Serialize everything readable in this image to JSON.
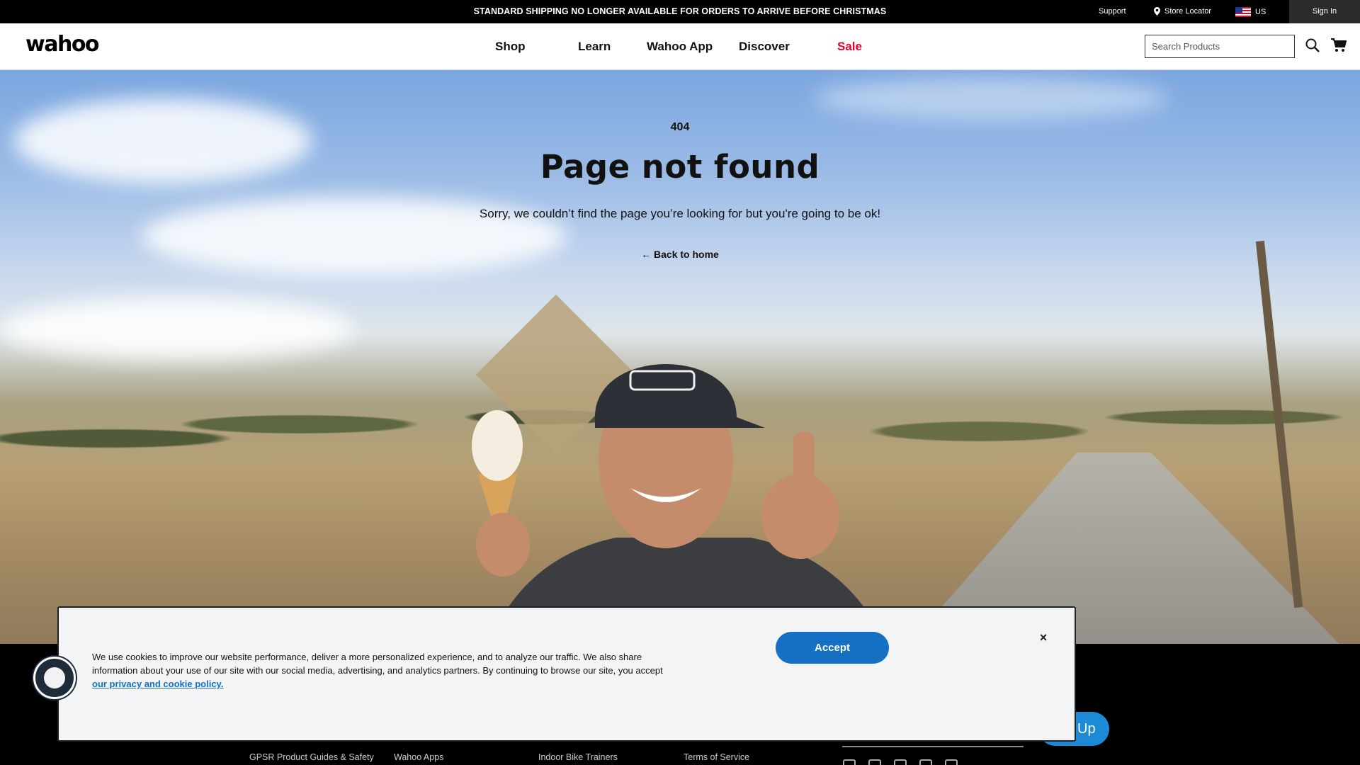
{
  "topbar": {
    "announcement": "STANDARD SHIPPING NO LONGER AVAILABLE FOR ORDERS TO ARRIVE BEFORE CHRISTMAS",
    "support": "Support",
    "store_locator": "Store Locator",
    "locale": "US",
    "sign_in": "Sign In"
  },
  "nav": {
    "logo": "wahoo",
    "items": [
      "Shop",
      "Learn",
      "Wahoo App",
      "Discover",
      "Sale"
    ],
    "search_placeholder": "Search Products"
  },
  "hero": {
    "code": "404",
    "title": "Page not found",
    "subtitle": "Sorry, we couldn’t find the page you’re looking for but you're going to be ok!",
    "back_link": "Back to home"
  },
  "footer": {
    "links": [
      "GPSR Product Guides & Safety",
      "Wahoo Apps",
      "Indoor Bike Trainers",
      "Terms of Service"
    ],
    "signup_label": "Up"
  },
  "cookie": {
    "text": "We use cookies to improve our website performance, deliver a more personalized experience, and to analyze our traffic. We also share information about your use of our site with our social media, advertising, and analytics partners. By continuing to browse our site, you accept ",
    "link": "our privacy and cookie policy.",
    "accept": "Accept",
    "close": "×"
  },
  "colors": {
    "accent": "#1570c4",
    "sale": "#e4002b"
  }
}
